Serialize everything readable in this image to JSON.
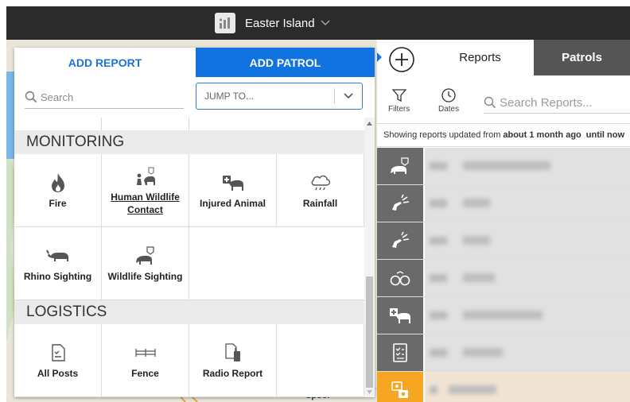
{
  "header": {
    "site_name": "Easter Island",
    "icons": {
      "logo": "site-logo-icon",
      "chevron": "chevron-down-icon"
    }
  },
  "map": {
    "label": "Spoor"
  },
  "add_panel": {
    "tabs": {
      "add_report": "ADD REPORT",
      "add_patrol": "ADD PATROL"
    },
    "search_placeholder": "Search",
    "jump_to": "JUMP TO...",
    "categories": [
      {
        "name": "MONITORING",
        "items": [
          {
            "label": "Fire",
            "icon": "fire-icon",
            "link": false
          },
          {
            "label": "Human Wildlife Contact",
            "icon": "human-wildlife-contact-icon",
            "link": true
          },
          {
            "label": "Injured Animal",
            "icon": "injured-animal-icon",
            "link": false
          },
          {
            "label": "Rainfall",
            "icon": "rainfall-icon",
            "link": false
          },
          {
            "label": "Rhino Sighting",
            "icon": "rhino-icon",
            "link": false
          },
          {
            "label": "Wildlife Sighting",
            "icon": "wildlife-sighting-icon",
            "link": false
          }
        ]
      },
      {
        "name": "LOGISTICS",
        "items": [
          {
            "label": "All Posts",
            "icon": "checklist-icon",
            "link": false
          },
          {
            "label": "Fence",
            "icon": "fence-icon",
            "link": false
          },
          {
            "label": "Radio Report",
            "icon": "radio-report-icon",
            "link": false
          }
        ]
      }
    ]
  },
  "sidebar": {
    "tabs": {
      "reports": "Reports",
      "patrols": "Patrols"
    },
    "tools": {
      "filters": "Filters",
      "dates": "Dates"
    },
    "search_placeholder": "Search Reports...",
    "showing": {
      "prefix": "Showing reports updated from",
      "from": "about 1 month ago",
      "until": "until now"
    },
    "report_icons": [
      "wildlife-sighting-icon",
      "gunshot-icon",
      "gunshot-icon",
      "handcuffs-icon",
      "injured-animal-icon",
      "checklist-icon",
      "camera-trap-icon"
    ],
    "colors": {
      "icon_bg": "#6a6a6a",
      "camera_trap": "#f6a623",
      "accent": "#1173df",
      "patrols_bg": "#555555"
    }
  }
}
